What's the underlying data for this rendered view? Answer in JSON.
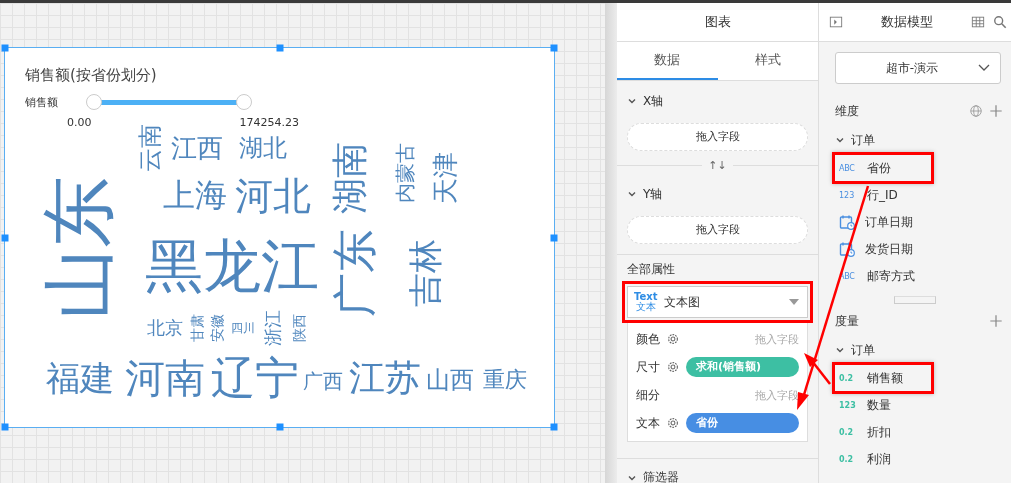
{
  "chart_card": {
    "title": "销售额(按省份划分)",
    "slider": {
      "label": "销售额",
      "min_label": "0.00",
      "max_label": "174254.23",
      "thumbs": [
        {
          "level": 0
        },
        {
          "level": 1
        }
      ]
    },
    "words": [
      {
        "text": "云南",
        "vertical": true
      },
      {
        "text": "江西",
        "vertical": false
      },
      {
        "text": "湖北",
        "vertical": false
      },
      {
        "text": "湖南",
        "vertical": true
      },
      {
        "text": "内蒙古",
        "vertical": true
      },
      {
        "text": "天津",
        "vertical": true
      },
      {
        "text": "山东",
        "vertical": true
      },
      {
        "text": "上海",
        "vertical": false
      },
      {
        "text": "河北",
        "vertical": false
      },
      {
        "text": "黑龙江",
        "vertical": false
      },
      {
        "text": "广东",
        "vertical": true
      },
      {
        "text": "吉林",
        "vertical": true
      },
      {
        "text": "北京",
        "vertical": false
      },
      {
        "text": "甘肃",
        "vertical": true
      },
      {
        "text": "安徽",
        "vertical": true
      },
      {
        "text": "四川",
        "vertical": false
      },
      {
        "text": "浙江",
        "vertical": true
      },
      {
        "text": "陕西",
        "vertical": true
      },
      {
        "text": "福建",
        "vertical": false
      },
      {
        "text": "河南",
        "vertical": false
      },
      {
        "text": "辽宁",
        "vertical": false
      },
      {
        "text": "广西",
        "vertical": false
      },
      {
        "text": "江苏",
        "vertical": false
      },
      {
        "text": "山西",
        "vertical": false
      },
      {
        "text": "重庆",
        "vertical": false
      }
    ]
  },
  "chart_panel": {
    "title": "图表",
    "tabs": [
      {
        "label": "数据",
        "selected": true
      },
      {
        "label": "样式",
        "selected": false
      }
    ],
    "axes": [
      {
        "label": "X轴",
        "expanded": true,
        "dropzone": "拖入字段"
      },
      {
        "label": "Y轴",
        "expanded": true,
        "dropzone": "拖入字段"
      }
    ],
    "swap": "↑↓",
    "properties_label": "全部属性",
    "chart_type": {
      "icon_text": "Text",
      "icon_subtext": "文本",
      "label": "文本图",
      "annotated": true
    },
    "properties": [
      {
        "label": "颜色",
        "settings": true,
        "kind": "empty",
        "value": "拖入字段"
      },
      {
        "label": "尺寸",
        "settings": true,
        "kind": "measure",
        "value": "求和(销售额)"
      },
      {
        "label": "细分",
        "settings": false,
        "kind": "empty",
        "value": "拖入字段"
      },
      {
        "label": "文本",
        "settings": true,
        "kind": "dimension",
        "value": "省份"
      }
    ],
    "filter": {
      "label": "筛选器",
      "expanded": true
    }
  },
  "model_panel": {
    "title": "数据模型",
    "dataset": "超市-演示",
    "dimensions": {
      "label": "维度",
      "group": {
        "label": "订单",
        "expanded": true,
        "items": [
          {
            "name": "省份",
            "kind": "text",
            "badge": "ABC",
            "annotated": true
          },
          {
            "name": "行_ID",
            "kind": "number",
            "badge": "123",
            "annotated": false
          },
          {
            "name": "订单日期",
            "kind": "date",
            "annotated": false
          },
          {
            "name": "发货日期",
            "kind": "date",
            "annotated": false
          },
          {
            "name": "邮寄方式",
            "kind": "text",
            "badge": "ABC",
            "annotated": false
          }
        ]
      }
    },
    "measures": {
      "label": "度量",
      "group": {
        "label": "订单",
        "expanded": true,
        "items": [
          {
            "name": "销售额",
            "kind": "number",
            "badge": "0.2",
            "annotated": true
          },
          {
            "name": "数量",
            "kind": "number",
            "badge": "123",
            "annotated": false
          },
          {
            "name": "折扣",
            "kind": "number",
            "badge": "0.2",
            "annotated": false
          },
          {
            "name": "利润",
            "kind": "number",
            "badge": "0.2",
            "annotated": false
          }
        ]
      }
    }
  }
}
